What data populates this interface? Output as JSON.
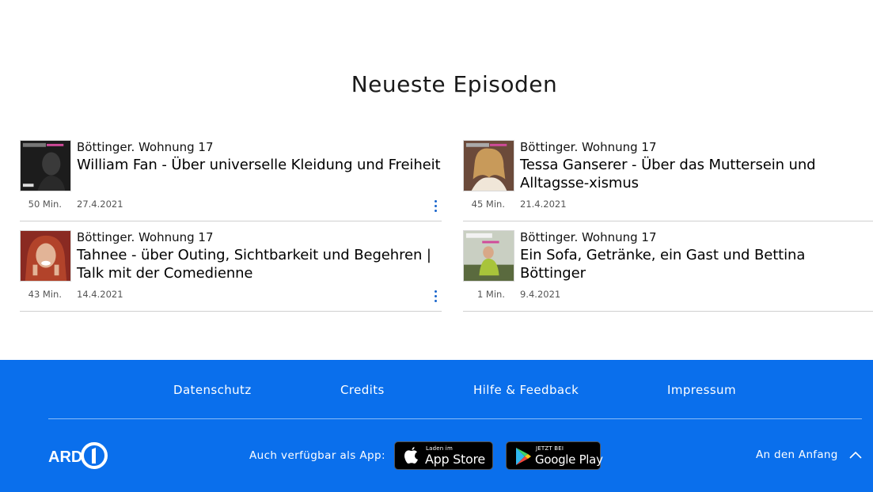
{
  "section_title": "Neueste Episoden",
  "episodes": [
    {
      "show": "Böttinger. Wohnung 17",
      "title": "William Fan - Über universelle Kleidung und Freiheit",
      "duration": "50 Min.",
      "date": "27.4.2021",
      "thumb_bg": "#1c1c1c"
    },
    {
      "show": "Böttinger. Wohnung 17",
      "title": "Tessa Ganserer - Über das Muttersein und Alltagsse-xismus",
      "duration": "45 Min.",
      "date": "21.4.2021",
      "thumb_bg": "#6b4a3a"
    },
    {
      "show": "Böttinger. Wohnung 17",
      "title": "Tahnee - über Outing, Sichtbarkeit und Begehren | Talk mit der Comedienne",
      "duration": "43 Min.",
      "date": "14.4.2021",
      "thumb_bg": "#8a2a22"
    },
    {
      "show": "Böttinger. Wohnung 17",
      "title": "Ein Sofa, Getränke, ein Gast und Bettina Böttinger",
      "duration": "1 Min.",
      "date": "9.4.2021",
      "thumb_bg": "#c9cfc2"
    }
  ],
  "footer": {
    "links": [
      "Datenschutz",
      "Credits",
      "Hilfe & Feedback",
      "Impressum"
    ],
    "logo_text": "ARD",
    "app_label": "Auch verfügbar als App:",
    "app_store": {
      "small": "Laden im",
      "big": "App Store"
    },
    "google_play": {
      "small": "JETZT BEI",
      "big": "Google Play"
    },
    "back_to_top": "An den Anfang",
    "bg_color": "#0a6fec"
  }
}
